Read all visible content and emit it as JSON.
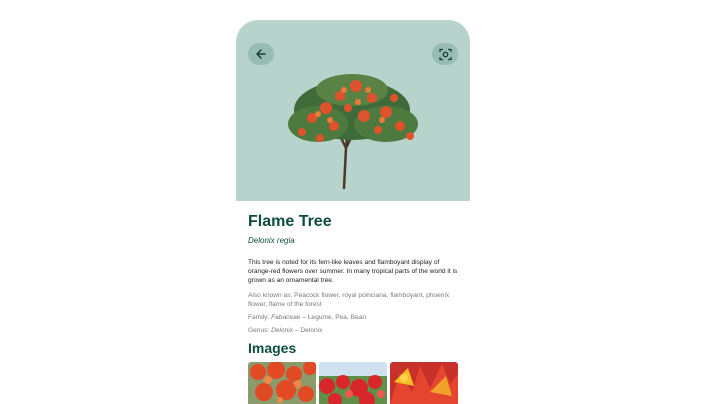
{
  "plant": {
    "name": "Flame Tree",
    "scientific_name": "Delonix regia",
    "description": "This tree is noted for its fern-like leaves and flamboyant display of orange-red flowers over summer. In many tropical parts of the world it is grown as an ornamental tree.",
    "also_known_as": "Also known as: Peacock flower, royal poinciana, flamboyant, phoenix flower, flame of the forest",
    "family_prefix": "Family: ",
    "family_italic": "Fabaceae",
    "family_suffix": " – Legume, Pea, Bean",
    "genus_prefix": "Genus: ",
    "genus_italic": "Delonix",
    "genus_suffix": " – Delonix"
  },
  "images_section": {
    "title": "Images"
  },
  "icons": {
    "back": "arrow-left-icon",
    "scan": "camera-scan-icon"
  },
  "colors": {
    "hero_bg": "#b8d3cc",
    "accent": "#0e4d3d",
    "button_bg": "#97bdb3"
  }
}
